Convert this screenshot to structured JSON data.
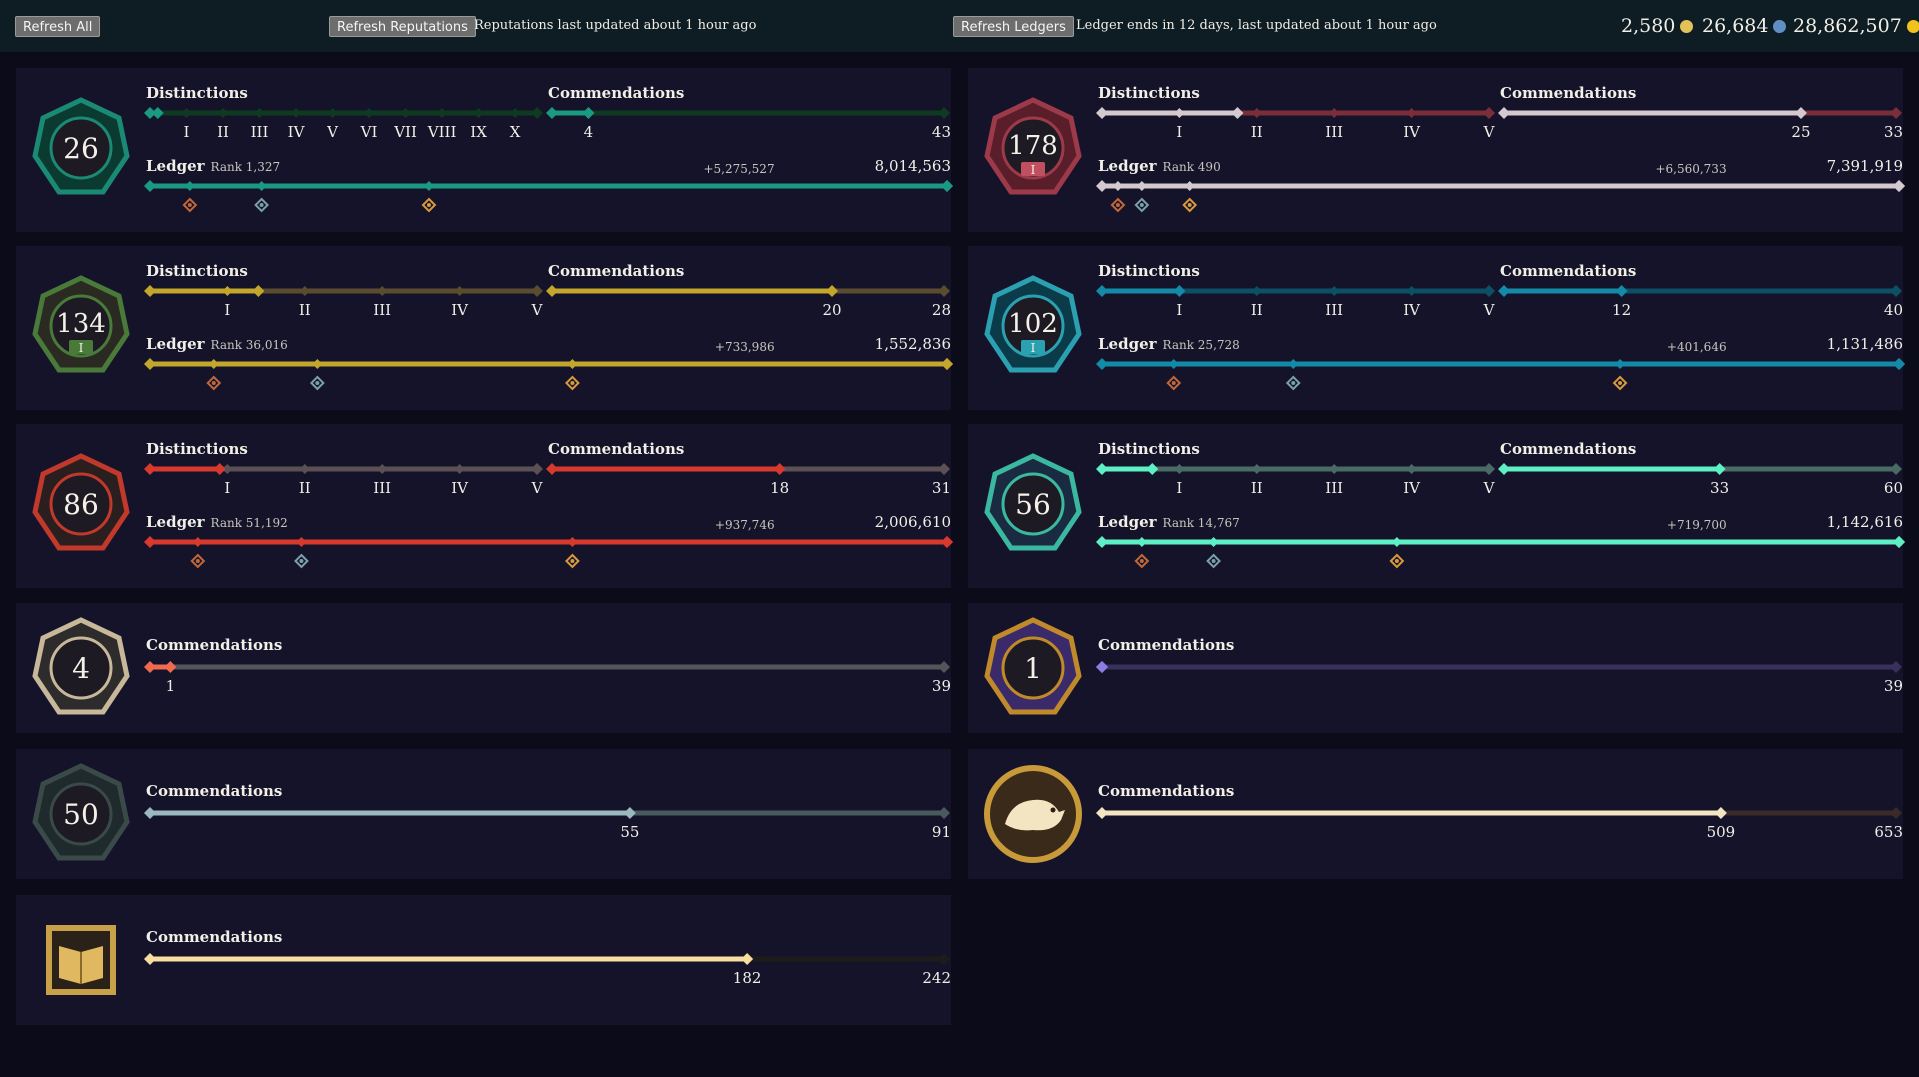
{
  "topbar": {
    "refresh_all": "Refresh All",
    "refresh_reputations": "Refresh Reputations",
    "reputations_status": "Reputations last updated about 1 hour ago",
    "refresh_ledgers": "Refresh Ledgers",
    "ledgers_status": "Ledger ends in 12 days, last updated about 1 hour ago",
    "currencies": [
      {
        "value": "2,580",
        "icon": "gold-coin-icon",
        "color": "#e3c25a"
      },
      {
        "value": "26,684",
        "icon": "doubloon-icon",
        "color": "#5f8fc4"
      },
      {
        "value": "28,862,507",
        "icon": "ancient-coin-icon",
        "color": "#f0c21c"
      }
    ]
  },
  "labels": {
    "distinctions": "Distinctions",
    "commendations": "Commendations",
    "ledger": "Ledger"
  },
  "factions": [
    {
      "id": "gold-hoarders",
      "emblem_level": "26",
      "emblem_icon": "treasure-chest-emblem-icon",
      "colors": {
        "fill": "#1a9a80",
        "track": "#0f3a22",
        "emblem": "#1a8a74",
        "emblem_bg": "#0b3a30"
      },
      "distinctions": {
        "progress": 0.02,
        "ticks": [
          "I",
          "II",
          "III",
          "IV",
          "V",
          "VI",
          "VII",
          "VIII",
          "IX",
          "X"
        ]
      },
      "commendations": {
        "current": 4,
        "total": 43,
        "current_label": "4",
        "total_label": "43"
      },
      "ledger": {
        "rank_label": "Rank 1,327",
        "gain": "+5,275,527",
        "total": "8,014,563",
        "markers": [
          0.05,
          0.14,
          0.35
        ],
        "marker_icons": [
          "bronze-diamond-icon",
          "silver-gem-icon",
          "gold-diamond-icon"
        ]
      }
    },
    {
      "id": "order-of-souls",
      "emblem_level": "178",
      "emblem_sub": "I",
      "emblem_icon": "soul-skull-emblem-icon",
      "colors": {
        "fill": "#d3c9cf",
        "track": "#7a2e3a",
        "emblem": "#9c3a4a",
        "emblem_bg": "#5a1e2a"
      },
      "distinctions": {
        "progress": 0.35,
        "ticks": [
          "I",
          "II",
          "III",
          "IV",
          "V"
        ]
      },
      "commendations": {
        "current": 25,
        "total": 33,
        "current_label": "25",
        "total_label": "33"
      },
      "ledger": {
        "rank_label": "Rank 490",
        "gain": "+6,560,733",
        "total": "7,391,919",
        "markers": [
          0.02,
          0.05,
          0.11
        ],
        "marker_icons": [
          "bronze-diamond-icon",
          "silver-gem-icon",
          "gold-diamond-icon"
        ]
      }
    },
    {
      "id": "merchant-alliance",
      "emblem_level": "134",
      "emblem_sub": "I",
      "emblem_icon": "merchant-emblem-icon",
      "colors": {
        "fill": "#c3a62c",
        "track": "#5a4c2e",
        "emblem": "#4a7a3a",
        "emblem_bg": "#2a2a22"
      },
      "distinctions": {
        "progress": 0.28,
        "ticks": [
          "I",
          "II",
          "III",
          "IV",
          "V"
        ]
      },
      "commendations": {
        "current": 20,
        "total": 28,
        "current_label": "20",
        "total_label": "28"
      },
      "ledger": {
        "rank_label": "Rank 36,016",
        "gain": "+733,986",
        "total": "1,552,836",
        "markers": [
          0.08,
          0.21,
          0.53
        ],
        "marker_icons": [
          "bronze-diamond-icon",
          "silver-gem-icon",
          "gold-diamond-icon"
        ]
      }
    },
    {
      "id": "athenas-fortune",
      "emblem_level": "102",
      "emblem_sub": "I",
      "emblem_icon": "athena-emblem-icon",
      "colors": {
        "fill": "#138aa8",
        "track": "#0d5066",
        "emblem": "#2aa0b0",
        "emblem_bg": "#0b3a48"
      },
      "distinctions": {
        "progress": 0.2,
        "ticks": [
          "I",
          "II",
          "III",
          "IV",
          "V"
        ]
      },
      "commendations": {
        "current": 12,
        "total": 40,
        "current_label": "12",
        "total_label": "40"
      },
      "ledger": {
        "rank_label": "Rank 25,728",
        "gain": "+401,646",
        "total": "1,131,486",
        "markers": [
          0.09,
          0.24,
          0.65
        ],
        "marker_icons": [
          "bronze-diamond-icon",
          "silver-gem-icon",
          "gold-diamond-icon"
        ]
      }
    },
    {
      "id": "reapers-bones",
      "emblem_level": "86",
      "emblem_icon": "reaper-emblem-icon",
      "colors": {
        "fill": "#d8392d",
        "track": "#5b5053",
        "emblem": "#c0392b",
        "emblem_bg": "#2a1e1e"
      },
      "distinctions": {
        "progress": 0.18,
        "ticks": [
          "I",
          "II",
          "III",
          "IV",
          "V"
        ]
      },
      "commendations": {
        "current": 18,
        "total": 31,
        "current_label": "18",
        "total_label": "31"
      },
      "ledger": {
        "rank_label": "Rank 51,192",
        "gain": "+937,746",
        "total": "2,006,610",
        "markers": [
          0.06,
          0.19,
          0.53
        ],
        "marker_icons": [
          "bronze-diamond-icon",
          "silver-gem-icon",
          "gold-diamond-icon"
        ]
      }
    },
    {
      "id": "hunters-call",
      "emblem_level": "56",
      "emblem_icon": "hunter-emblem-icon",
      "colors": {
        "fill": "#5ef0c4",
        "track": "#4a6b63",
        "emblem": "#3bb8a0",
        "emblem_bg": "#1a2a40"
      },
      "distinctions": {
        "progress": 0.13,
        "ticks": [
          "I",
          "II",
          "III",
          "IV",
          "V"
        ]
      },
      "commendations": {
        "current": 33,
        "total": 60,
        "current_label": "33",
        "total_label": "60"
      },
      "ledger": {
        "rank_label": "Rank 14,767",
        "gain": "+719,700",
        "total": "1,142,616",
        "markers": [
          0.05,
          0.14,
          0.37
        ],
        "marker_icons": [
          "bronze-diamond-icon",
          "silver-gem-icon",
          "gold-diamond-icon"
        ]
      }
    },
    {
      "id": "guardians-of-fortune",
      "emblem_level": "4",
      "emblem_icon": "crossed-bones-emblem-icon",
      "colors": {
        "fill": "#f06a50",
        "track": "#55545a",
        "emblem": "#c8b89a",
        "emblem_bg": "#2e2b2c"
      },
      "commendations": {
        "current": 1,
        "total": 39,
        "current_label": "1",
        "total_label": "39"
      }
    },
    {
      "id": "servants-of-the-flame",
      "emblem_level": "1",
      "emblem_icon": "flame-emblem-icon",
      "colors": {
        "fill": "#8a7ee0",
        "track": "#3a305c",
        "emblem": "#c08a2a",
        "emblem_bg": "#3a2a6a"
      },
      "commendations": {
        "current": 0,
        "total": 39,
        "current_label": "",
        "total_label": "39"
      }
    },
    {
      "id": "sea-dogs",
      "emblem_level": "50",
      "emblem_icon": "seadog-emblem-icon",
      "colors": {
        "fill": "#9ab8c0",
        "track": "#4a5a5c",
        "emblem": "#3a4a48",
        "emblem_bg": "#1e2a2c"
      },
      "commendations": {
        "current": 55,
        "total": 91,
        "current_label": "55",
        "total_label": "91"
      }
    },
    {
      "id": "rat-companion",
      "emblem_icon": "rat-emblem-icon",
      "colors": {
        "fill": "#f3e5c2",
        "track": "#3a2a28",
        "emblem": "#c89a3a",
        "emblem_bg": "#3a2a1a"
      },
      "commendations": {
        "current": 509,
        "total": 653,
        "current_label": "509",
        "total_label": "653"
      }
    },
    {
      "id": "pirate-lord",
      "emblem_icon": "open-book-emblem-icon",
      "colors": {
        "fill": "#f8dfa0",
        "track": "#1e1c1a",
        "emblem": "#c8a04a",
        "emblem_bg": "#2a2218"
      },
      "commendations": {
        "current": 182,
        "total": 242,
        "current_label": "182",
        "total_label": "242"
      }
    }
  ]
}
